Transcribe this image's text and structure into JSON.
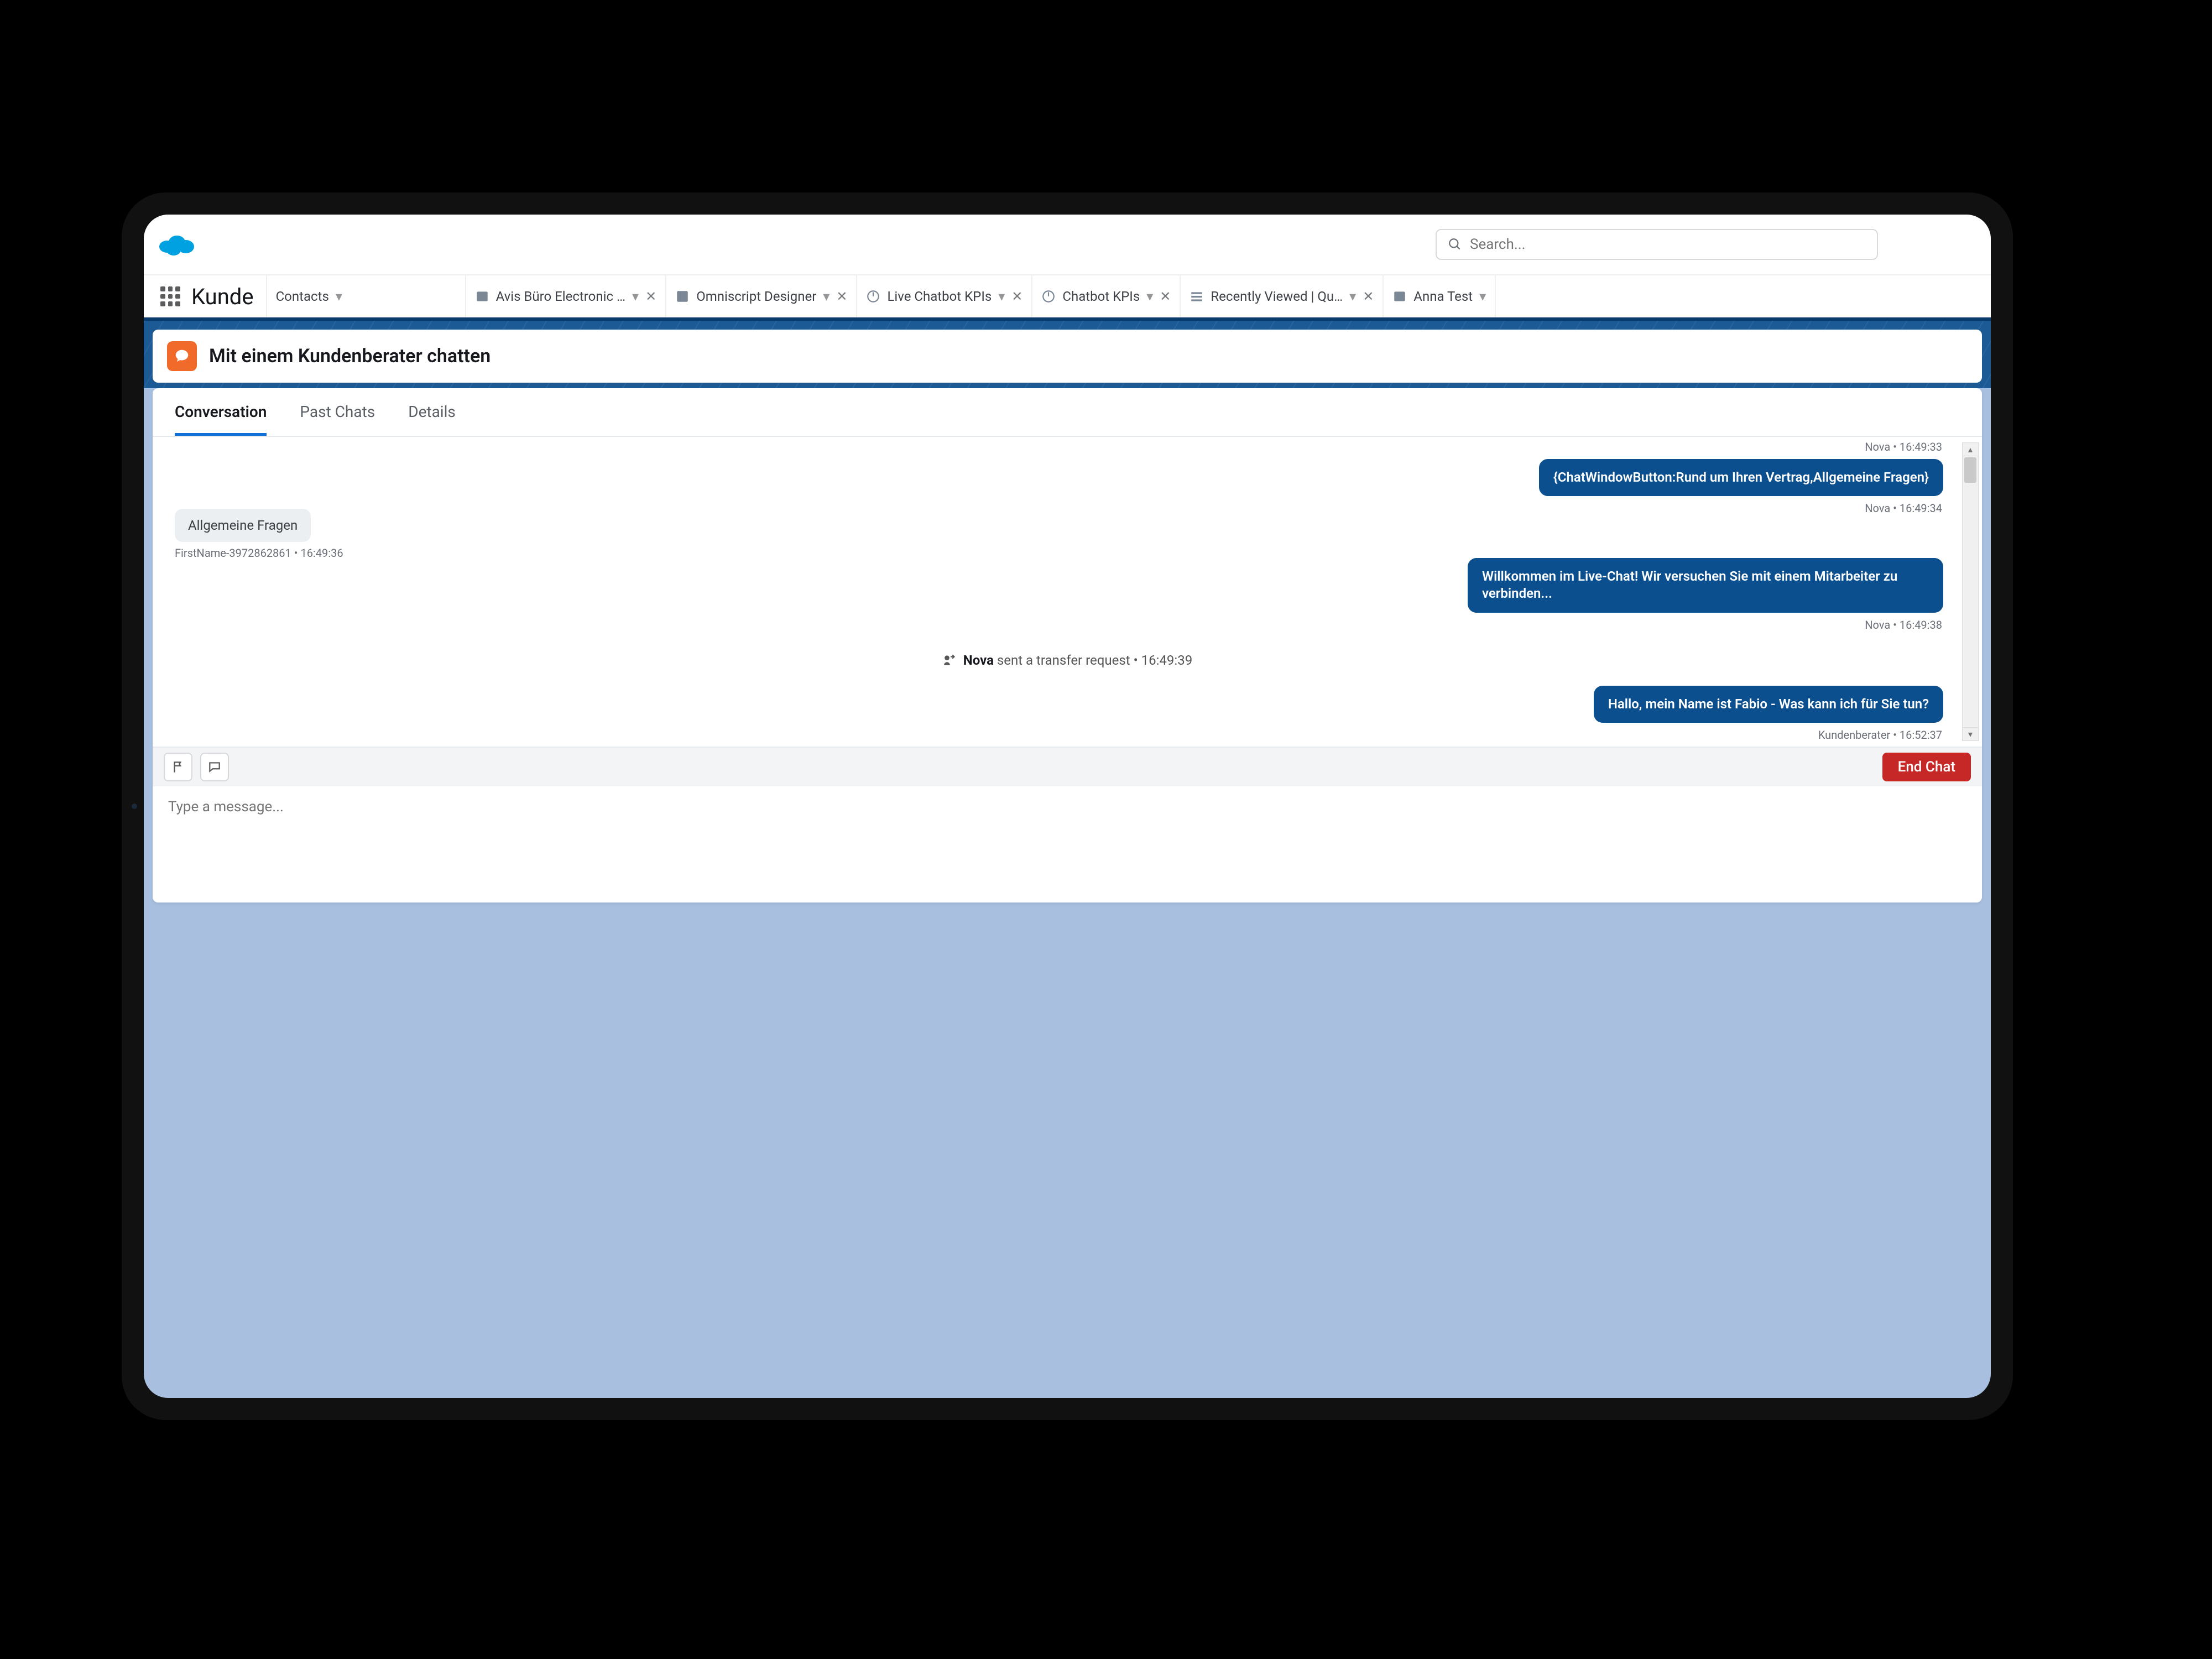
{
  "search": {
    "placeholder": "Search..."
  },
  "app_name": "Kunde",
  "nav_tabs": [
    {
      "label": "Contacts",
      "closable": false
    },
    {
      "label": "Avis Büro Electronic …",
      "closable": true
    },
    {
      "label": "Omniscript Designer",
      "closable": true
    },
    {
      "label": "Live Chatbot KPIs",
      "closable": true
    },
    {
      "label": "Chatbot KPIs",
      "closable": true
    },
    {
      "label": "Recently Viewed | Qu…",
      "closable": true
    },
    {
      "label": "Anna Test",
      "closable": false
    }
  ],
  "page_title": "Mit einem Kundenberater chatten",
  "content_tabs": {
    "conversation": "Conversation",
    "past_chats": "Past Chats",
    "details": "Details"
  },
  "agent_messages": [
    {
      "meta": "Nova • 16:49:33",
      "text": "{ChatWindowButton:Rund um Ihren Vertrag,Allgemeine Fragen}"
    },
    {
      "meta": "Nova • 16:49:34",
      "text": ""
    },
    {
      "meta": "Nova • 16:49:38",
      "text": "Willkommen im Live-Chat! Wir versuchen Sie mit einem Mitarbeiter zu verbinden..."
    },
    {
      "meta": "Kundenberater • 16:52:37",
      "text": "Hallo, mein Name ist Fabio - Was kann ich für Sie tun?"
    }
  ],
  "customer_message": {
    "text": "Allgemeine Fragen",
    "meta": "FirstName-3972862861 • 16:49:36"
  },
  "system_event": {
    "actor": "Nova",
    "text": "sent a transfer request",
    "time": "16:49:39"
  },
  "composer": {
    "placeholder": "Type a message...",
    "end_button": "End Chat"
  }
}
